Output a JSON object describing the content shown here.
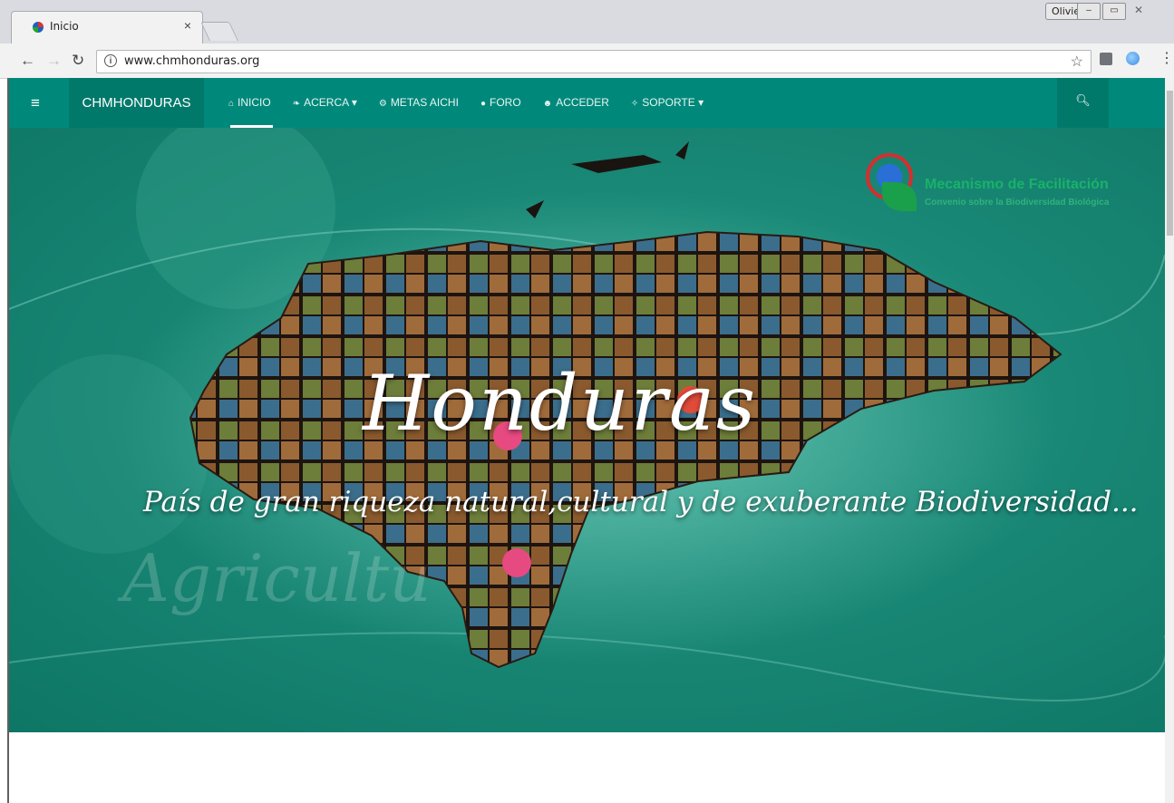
{
  "browser": {
    "tab_title": "Inicio",
    "profile_name": "Olivier",
    "url": "www.chmhonduras.org",
    "icons": [
      "back-arrow-icon",
      "forward-arrow-icon",
      "reload-icon",
      "info-icon",
      "star-icon",
      "extension-icon",
      "extension-globe-icon",
      "menu-dots-icon"
    ]
  },
  "site": {
    "brand": "CHMHONDURAS",
    "nav": [
      {
        "label": "INICIO",
        "icon": "home-icon",
        "glyph": "⌂",
        "caret": ""
      },
      {
        "label": "ACERCA",
        "icon": "leaf-icon",
        "glyph": "❧",
        "caret": "▾"
      },
      {
        "label": "METAS AICHI",
        "icon": "cogs-icon",
        "glyph": "⚙",
        "caret": ""
      },
      {
        "label": "FORO",
        "icon": "comment-icon",
        "glyph": "●",
        "caret": ""
      },
      {
        "label": "ACCEDER",
        "icon": "users-icon",
        "glyph": "☻",
        "caret": ""
      },
      {
        "label": "SOPORTE",
        "icon": "support-icon",
        "glyph": "✧",
        "caret": "▾"
      }
    ],
    "hero": {
      "title": "Honduras",
      "subtitle": "País de gran riqueza natural,cultural y de exuberante Biodiversidad...",
      "background_word": "Agricultu",
      "logo_title": "Mecanismo de Facilitación",
      "logo_subtitle": "Convenio sobre la Biodiversidad Biológica"
    },
    "colors": {
      "navbar": "#00897b",
      "navbar_dark": "#00796b",
      "hero": "#1b8a78"
    }
  }
}
